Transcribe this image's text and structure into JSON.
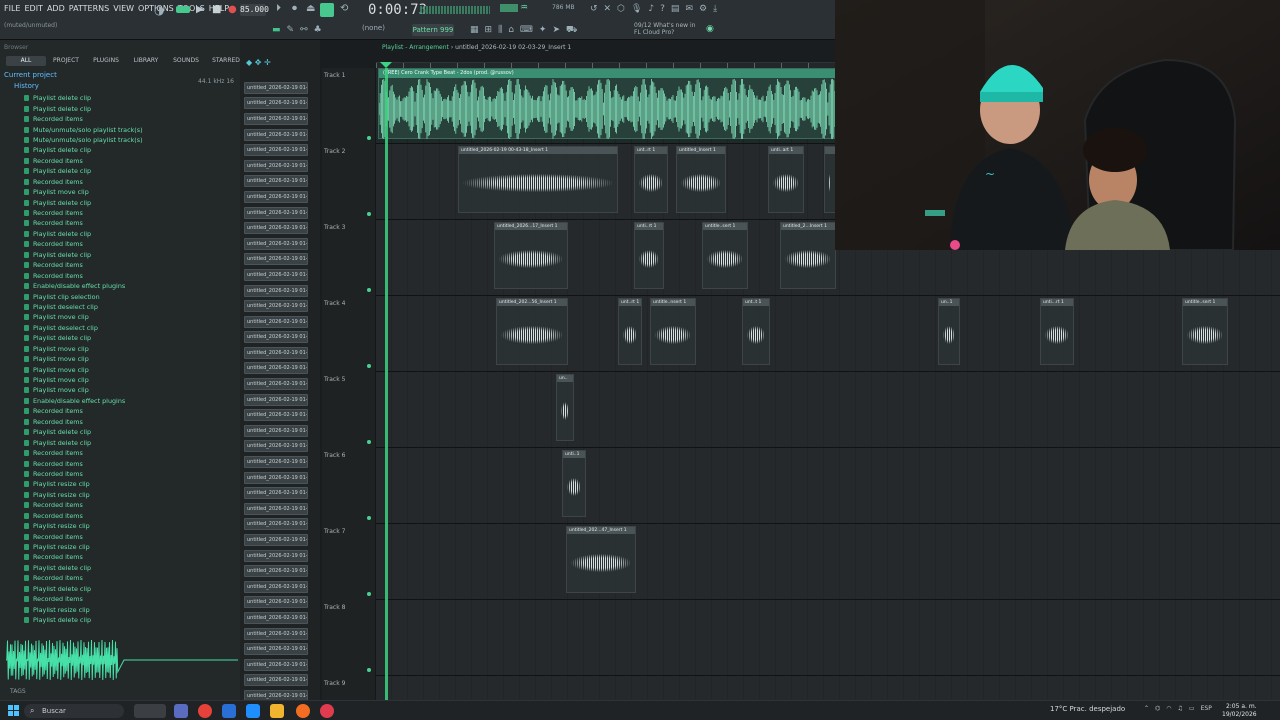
{
  "menu": [
    "FILE",
    "EDIT",
    "ADD",
    "PATTERNS",
    "VIEW",
    "OPTIONS",
    "TOOLS",
    "HELP"
  ],
  "toolbar": {
    "tempo": "85.000",
    "time": "0:00:73",
    "pattern": "Pattern 999",
    "mode": "(none)",
    "cpu": "786 MB",
    "news": "09/12 What's new in FL Cloud Pro?",
    "status": "(muted/unmuted)"
  },
  "browser": {
    "header": "Browser",
    "tabs": [
      "ALL",
      "PROJECT",
      "PLUGINS",
      "LIBRARY",
      "SOUNDS",
      "STARRED"
    ],
    "current_project": "Current project",
    "history": "History",
    "items": [
      "Playlist delete clip",
      "Playlist delete clip",
      "Recorded items",
      "Mute/unmute/solo playlist track(s)",
      "Mute/unmute/solo playlist track(s)",
      "Playlist delete clip",
      "Recorded items",
      "Playlist delete clip",
      "Recorded items",
      "Playlist move clip",
      "Playlist delete clip",
      "Recorded items",
      "Recorded items",
      "Playlist delete clip",
      "Recorded items",
      "Playlist delete clip",
      "Recorded items",
      "Recorded items",
      "Enable/disable effect plugins",
      "Playlist clip selection",
      "Playlist deselect clip",
      "Playlist move clip",
      "Playlist deselect clip",
      "Playlist delete clip",
      "Playlist move clip",
      "Playlist move clip",
      "Playlist move clip",
      "Playlist move clip",
      "Playlist move clip",
      "Enable/disable effect plugins",
      "Recorded items",
      "Recorded items",
      "Playlist delete clip",
      "Playlist delete clip",
      "Recorded items",
      "Recorded items",
      "Recorded items",
      "Playlist resize clip",
      "Playlist resize clip",
      "Recorded items",
      "Recorded items",
      "Playlist resize clip",
      "Recorded items",
      "Playlist resize clip",
      "Recorded items",
      "Playlist delete clip",
      "Recorded items",
      "Playlist delete clip",
      "Recorded items",
      "Playlist resize clip",
      "Playlist delete clip"
    ],
    "preview_freq": "44.1 kHz 16",
    "tags": "TAGS"
  },
  "cliplist": {
    "items": [
      "untitled_2026-02-19 01-",
      "untitled_2026-02-19 01-",
      "untitled_2026-02-19 01-",
      "untitled_2026-02-19 01-",
      "untitled_2026-02-19 01-",
      "untitled_2026-02-19 01-",
      "untitled_2026-02-19 01-",
      "untitled_2026-02-19 01-",
      "untitled_2026-02-19 01-",
      "untitled_2026-02-19 01-",
      "untitled_2026-02-19 01-",
      "untitled_2026-02-19 01-",
      "untitled_2026-02-19 01-",
      "untitled_2026-02-19 01-",
      "untitled_2026-02-19 01-",
      "untitled_2026-02-19 01-",
      "untitled_2026-02-19 01-",
      "untitled_2026-02-19 01-",
      "untitled_2026-02-19 01-",
      "untitled_2026-02-19 01-",
      "untitled_2026-02-19 01-",
      "untitled_2026-02-19 01-",
      "untitled_2026-02-19 01-",
      "untitled_2026-02-19 01-",
      "untitled_2026-02-19 01-",
      "untitled_2026-02-19 01-",
      "untitled_2026-02-19 01-",
      "untitled_2026-02-19 01-",
      "untitled_2026-02-19 01-",
      "untitled_2026-02-19 01-",
      "untitled_2026-02-19 01-",
      "untitled_2026-02-19 01-",
      "untitled_2026-02-19 01-",
      "untitled_2026-02-19 01-",
      "untitled_2026-02-19 01-",
      "untitled_2026-02-19 01-",
      "untitled_2026-02-19 01-",
      "untitled_2026-02-19 01-",
      "untitled_2026-02-19 01-",
      "untitled_2026-02-19 01-",
      "untitled_2026-02-19 02-"
    ]
  },
  "playlist": {
    "title": "Playlist - Arrangement",
    "file": "untitled_2026-02-19 02-03-29_Insert 1"
  },
  "tracks": [
    {
      "label": "Track 1",
      "clips": [
        {
          "name": "(FREE) Cero  Crank Type Beat - 2dos (prod. @russov)"
        }
      ]
    },
    {
      "label": "Track 2",
      "clips": [
        {
          "name": "untitled_2026-02-19 00-43-18_Insert 1"
        },
        {
          "name": "unt..rt 1"
        },
        {
          "name": "untitled_Insert 1"
        },
        {
          "name": "unti..art 1"
        },
        {
          "name": ""
        }
      ]
    },
    {
      "label": "Track 3",
      "clips": [
        {
          "name": "untitled_2026...17_Insert 1"
        },
        {
          "name": "unti..rt 1"
        },
        {
          "name": "untitle..sert 1"
        },
        {
          "name": "untitled_2...Insert 1"
        }
      ]
    },
    {
      "label": "Track 4",
      "clips": [
        {
          "name": "untitled_202...56_Insert 1"
        },
        {
          "name": "unt..rt 1"
        },
        {
          "name": "untitle..nsert 1"
        },
        {
          "name": "unt..t 1"
        },
        {
          "name": "un..1"
        },
        {
          "name": "unti...rt 1"
        },
        {
          "name": "untitle..sert 1"
        }
      ]
    },
    {
      "label": "Track 5",
      "clips": [
        {
          "name": "un.."
        }
      ]
    },
    {
      "label": "Track 6",
      "clips": [
        {
          "name": "unti..1"
        }
      ]
    },
    {
      "label": "Track 7",
      "clips": [
        {
          "name": "untitled_202...47_Insert 1"
        }
      ]
    },
    {
      "label": "Track 8",
      "clips": []
    },
    {
      "label": "Track 9",
      "clips": []
    }
  ],
  "taskbar": {
    "search": "Buscar",
    "weather": "17°C  Prac. despejado",
    "lang": "ESP",
    "time": "2:05 a. m.",
    "date": "19/02/2026"
  }
}
